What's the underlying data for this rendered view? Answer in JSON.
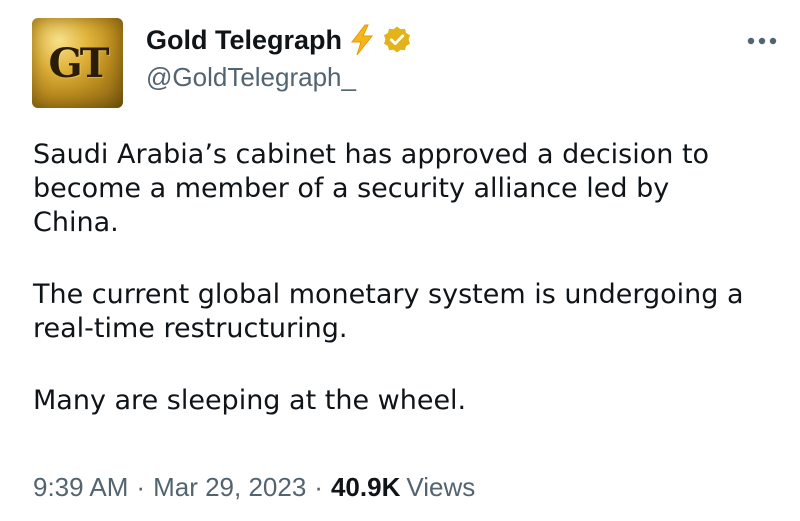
{
  "account": {
    "avatar_text": "GT",
    "display_name": "Gold Telegraph",
    "handle": "@GoldTelegraph_",
    "name_emoji_icon": "lightning-bolt-icon",
    "verified_icon": "verified-badge-icon"
  },
  "menu": {
    "more_icon": "more-options-icon"
  },
  "tweet": {
    "paragraphs": [
      "Saudi Arabia’s cabinet has approved a decision to\nbecome a member of a security alliance led by\nChina.",
      "The current global monetary system is undergoing a\nreal-time restructuring.",
      "Many are sleeping at the wheel."
    ]
  },
  "meta": {
    "time": "9:39 AM",
    "separator": "·",
    "date": "Mar 29, 2023",
    "views_count": "40.9K",
    "views_label": "Views"
  },
  "colors": {
    "text_primary": "#0f1419",
    "text_secondary": "#536471",
    "bolt": "#f7b51c",
    "verified_badge": "#e2b419"
  }
}
